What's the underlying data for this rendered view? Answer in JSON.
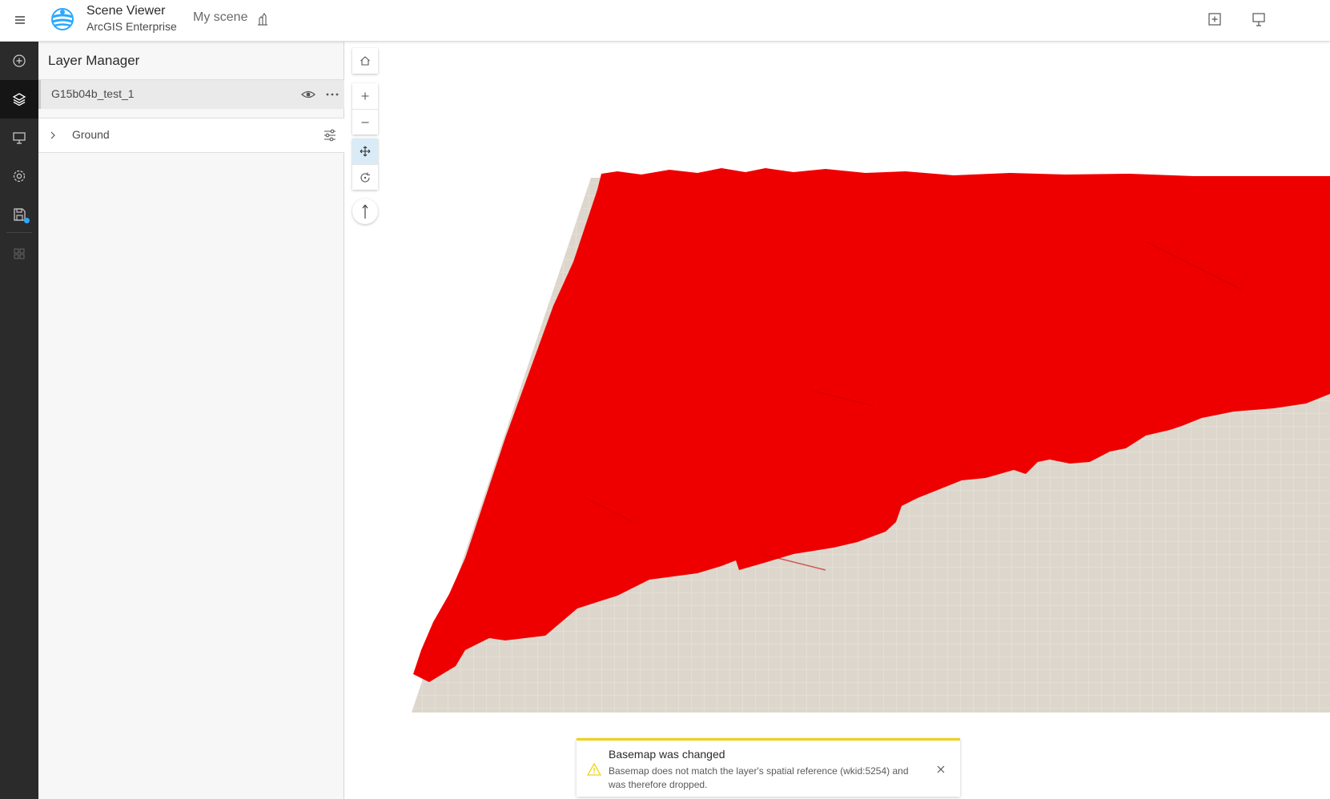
{
  "header": {
    "app_title": "Scene Viewer",
    "app_subtitle": "ArcGIS Enterprise",
    "scene_name": "My scene",
    "icons": [
      "menu-icon",
      "globe-logo",
      "scene-properties-icon",
      "add-icon",
      "presentation-icon"
    ]
  },
  "action_bar": {
    "items": [
      "add",
      "layers",
      "slides",
      "settings",
      "save",
      "apps"
    ],
    "active": "layers"
  },
  "panel": {
    "title": "Layer Manager",
    "layer": {
      "name": "G15b04b_test_1"
    },
    "ground": {
      "name": "Ground"
    }
  },
  "view_controls": [
    "home",
    "zoom-in",
    "zoom-out",
    "pan",
    "rotate",
    "compass"
  ],
  "notice": {
    "title": "Basemap was changed",
    "message": "Basemap does not match the layer's spatial reference (wkid:5254) and was therefore dropped."
  },
  "colors": {
    "accent": "#2aa8ff",
    "layer_fill": "#ef0000",
    "ground": "#ddd6cc",
    "warning": "#edd317"
  }
}
